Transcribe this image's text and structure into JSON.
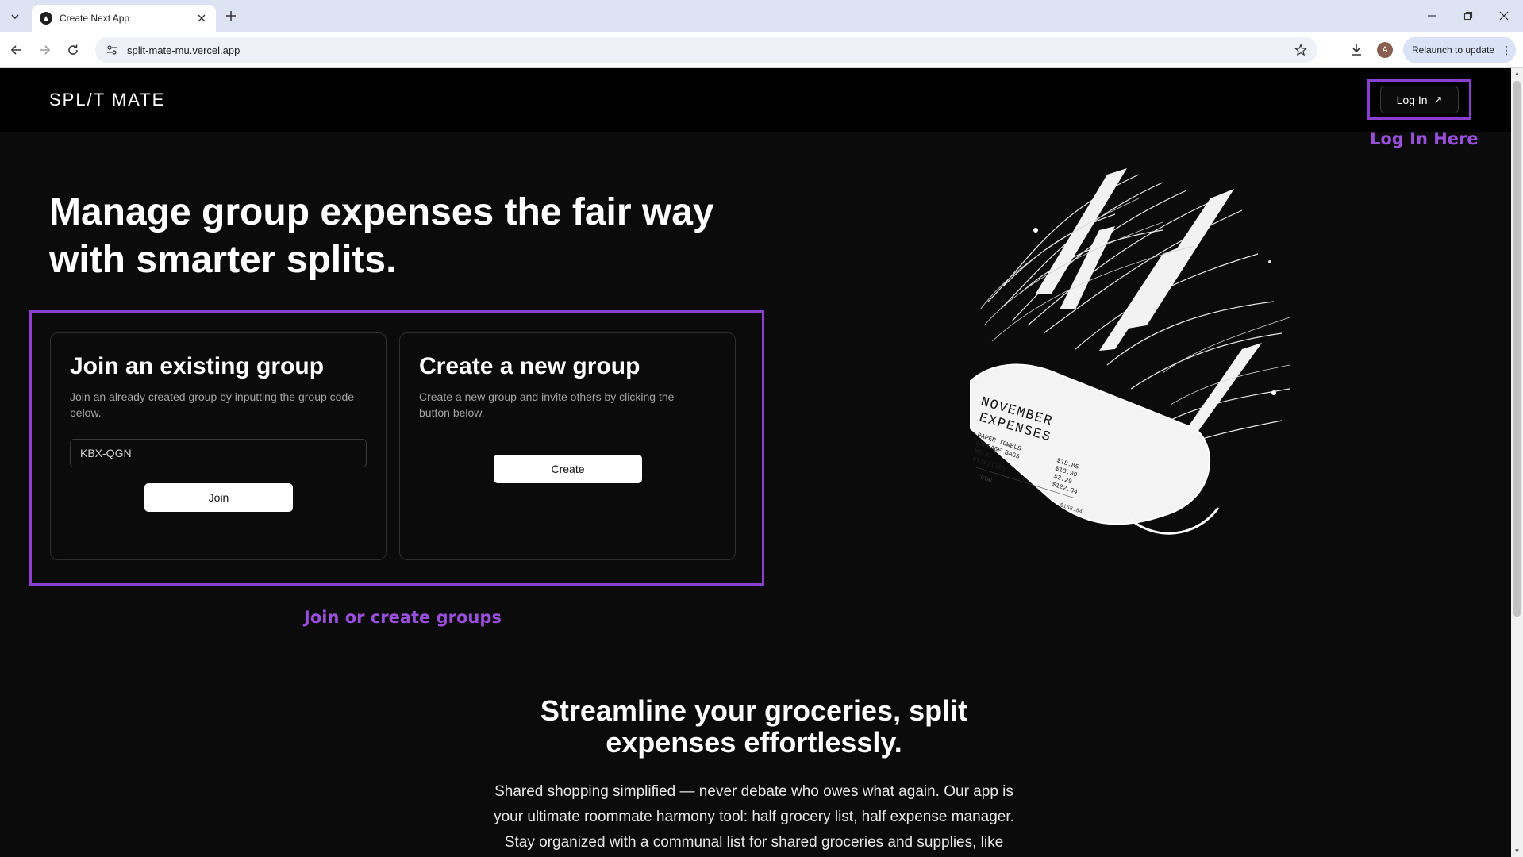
{
  "browser": {
    "tab_title": "Create Next App",
    "url": "split-mate-mu.vercel.app",
    "profile_initial": "A",
    "relaunch_label": "Relaunch to update"
  },
  "header": {
    "brand": "SPL/T MATE",
    "login_label": "Log In"
  },
  "annotations": {
    "login_note": "Log In Here",
    "cards_note": "Join or create groups",
    "highlight_color": "#8a3fd1"
  },
  "hero": {
    "title_line1": "Manage group expenses the fair way",
    "title_line2": "with smarter splits."
  },
  "join_card": {
    "title": "Join an existing group",
    "description": "Join an already created group by inputting the group code below.",
    "code_value": "KBX-QGN",
    "button_label": "Join"
  },
  "create_card": {
    "title": "Create a new group",
    "description": "Create a new group and invite others by clicking the button below.",
    "button_label": "Create"
  },
  "receipt": {
    "heading_line1": "NOVEMBER",
    "heading_line2": "EXPENSES",
    "items": [
      "PAPER TOWELS",
      "GARBAGE BAGS",
      "MILK",
      "UTILITIES"
    ],
    "prices": [
      "$18.85",
      "$13.99",
      "$3.29",
      "$122.34"
    ],
    "total_label": "TOTAL",
    "total_value": "$158.84"
  },
  "section": {
    "title_line1": "Streamline your groceries, split",
    "title_line2": "expenses effortlessly.",
    "body_line1": "Shared shopping simplified — never debate who owes what again. Our app is",
    "body_line2": "your ultimate roommate harmony tool: half grocery list, half expense manager.",
    "body_line3": "Stay organized with a communal list for shared groceries and supplies, like"
  }
}
